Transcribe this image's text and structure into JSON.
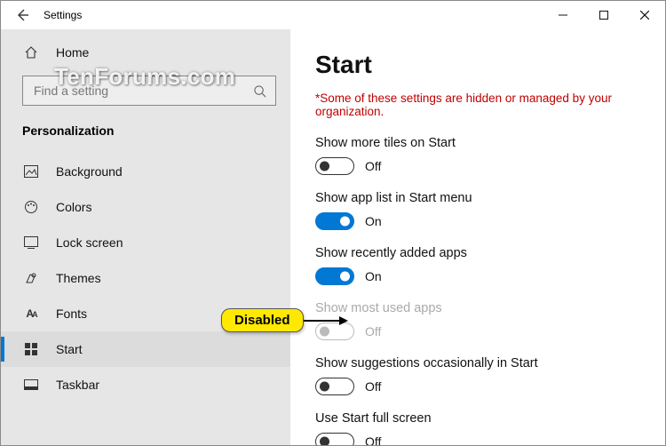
{
  "window": {
    "title": "Settings"
  },
  "watermark": "TenForums.com",
  "sidebar": {
    "home": "Home",
    "search_placeholder": "Find a setting",
    "category": "Personalization",
    "items": [
      {
        "label": "Background"
      },
      {
        "label": "Colors"
      },
      {
        "label": "Lock screen"
      },
      {
        "label": "Themes"
      },
      {
        "label": "Fonts"
      },
      {
        "label": "Start"
      },
      {
        "label": "Taskbar"
      }
    ]
  },
  "content": {
    "title": "Start",
    "warning": "*Some of these settings are hidden or managed by your organization.",
    "settings": [
      {
        "label": "Show more tiles on Start",
        "on": false,
        "state": "Off"
      },
      {
        "label": "Show app list in Start menu",
        "on": true,
        "state": "On"
      },
      {
        "label": "Show recently added apps",
        "on": true,
        "state": "On"
      },
      {
        "label": "Show most used apps",
        "on": false,
        "state": "Off",
        "disabled": true
      },
      {
        "label": "Show suggestions occasionally in Start",
        "on": false,
        "state": "Off"
      },
      {
        "label": "Use Start full screen",
        "on": false,
        "state": "Off"
      }
    ]
  },
  "callout": {
    "text": "Disabled"
  }
}
